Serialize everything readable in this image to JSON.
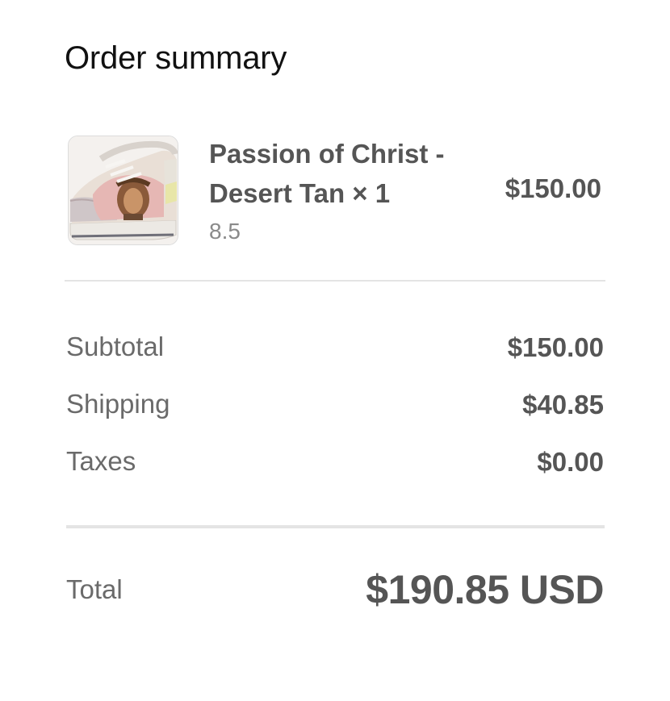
{
  "header": {
    "title": "Order summary"
  },
  "item": {
    "name": "Passion of Christ - Desert Tan × 1",
    "price": "$150.00",
    "variant": "8.5",
    "thumbnail": "sneaker-product-image"
  },
  "totals": {
    "subtotal_label": "Subtotal",
    "subtotal_value": "$150.00",
    "shipping_label": "Shipping",
    "shipping_value": "$40.85",
    "taxes_label": "Taxes",
    "taxes_value": "$0.00"
  },
  "grand_total": {
    "label": "Total",
    "value": "$190.85 USD"
  },
  "colors": {
    "text_primary": "#555555",
    "text_heading": "#111111",
    "text_muted": "#8a8a8a",
    "divider": "#e4e4e4"
  }
}
